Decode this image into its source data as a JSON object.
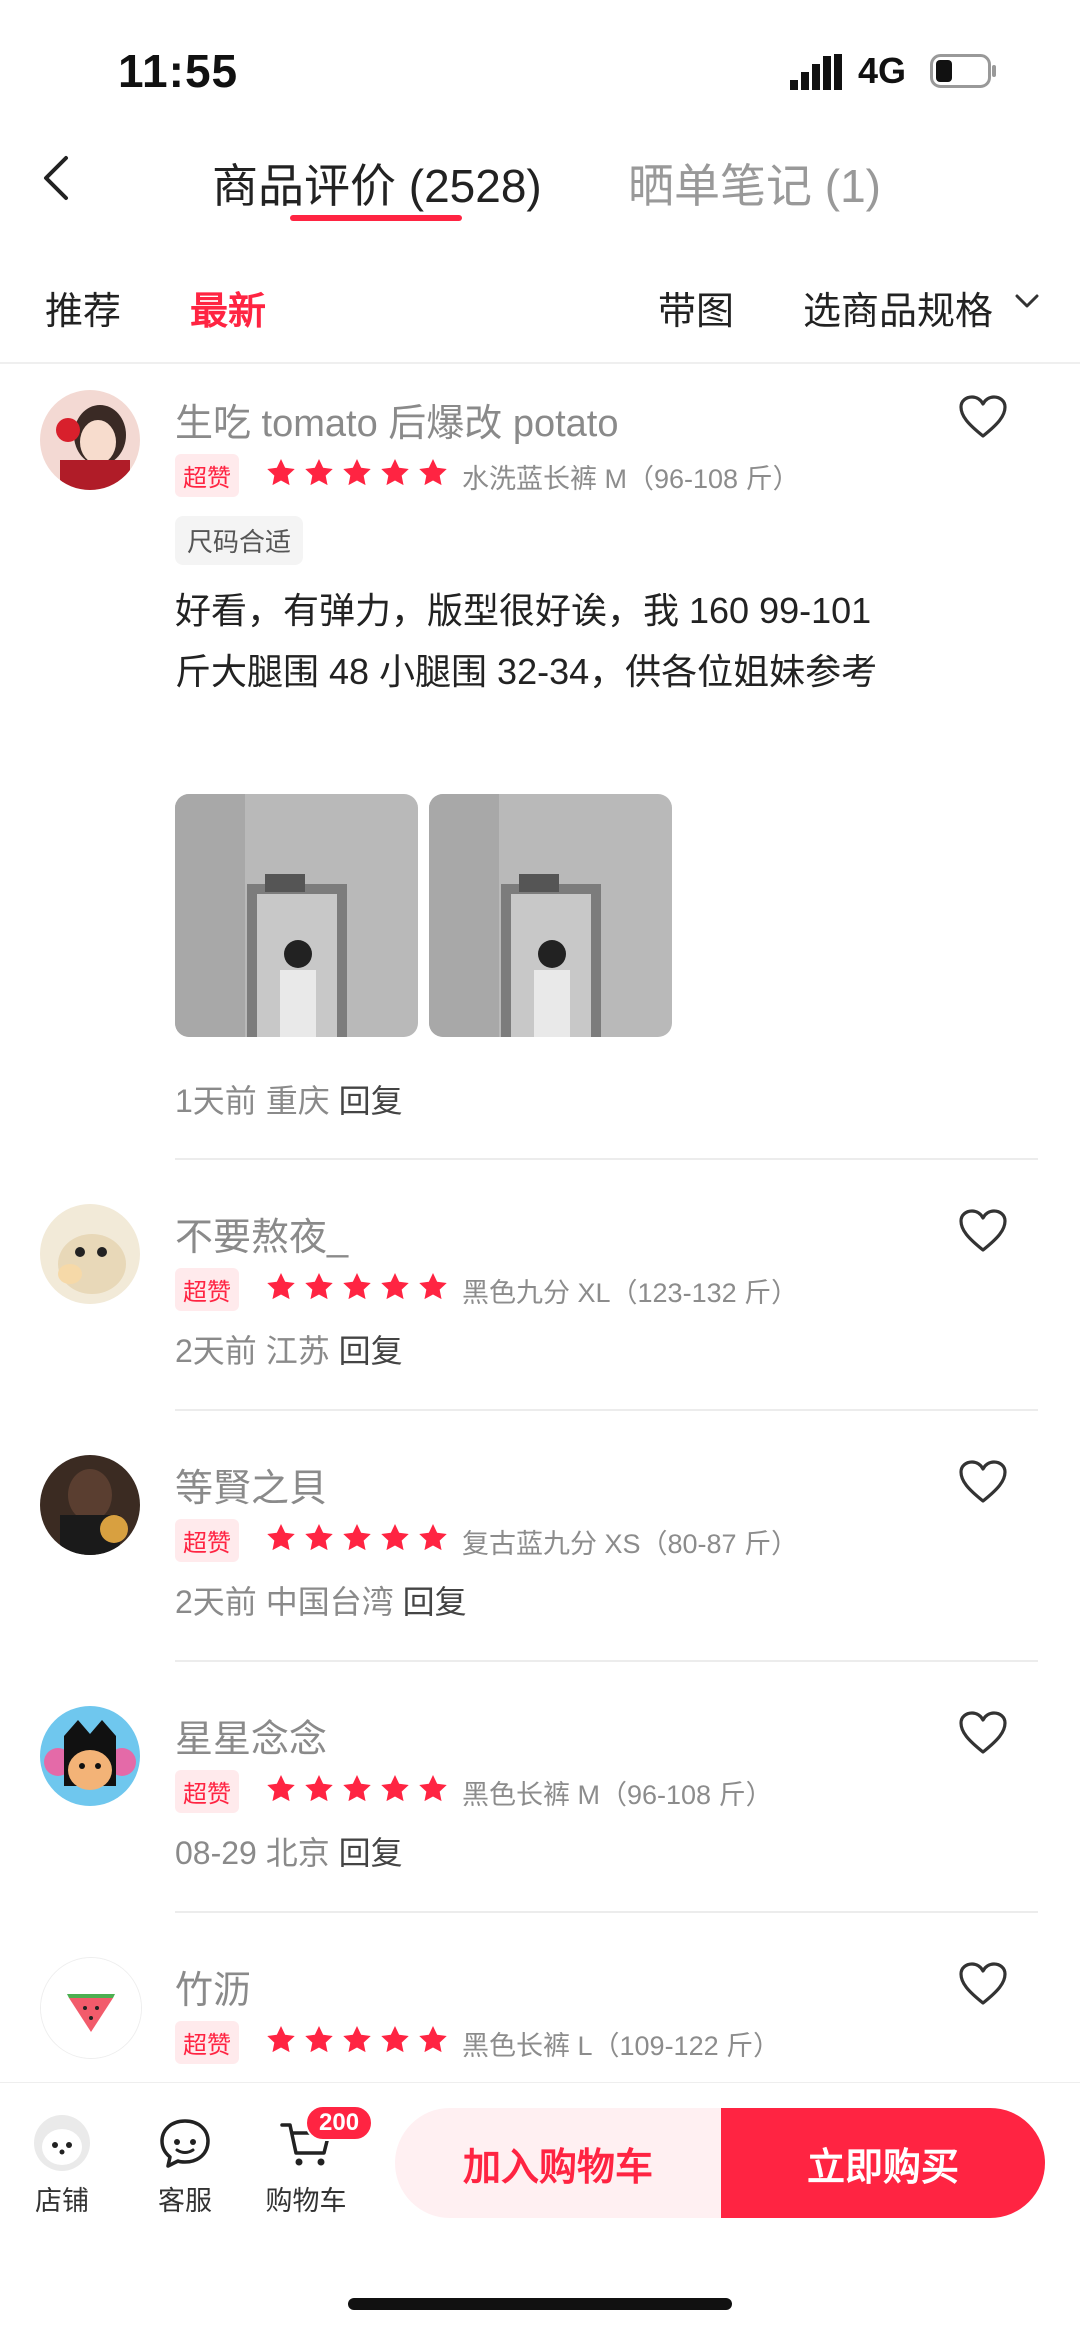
{
  "status": {
    "time": "11:55",
    "network": "4G"
  },
  "header": {
    "tabs": [
      {
        "label": "商品评价 (2528)",
        "active": true
      },
      {
        "label": "晒单笔记 (1)",
        "active": false
      }
    ]
  },
  "filters": {
    "recommend": "推荐",
    "latest": "最新",
    "with_images": "带图",
    "select_spec": "选商品规格"
  },
  "reviews": [
    {
      "name": "生吃 tomato 后爆改 potato",
      "badge": "超赞",
      "rating": 5,
      "spec": "水洗蓝长裤   M（96-108 斤）",
      "tag": "尺码合适",
      "text": "好看，有弹力，版型很好诶，我 160 99-101 斤大腿围 48 小腿围 32-34，供各位姐妹参考",
      "time_location": "1天前 重庆",
      "reply": "回复"
    },
    {
      "name": "不要熬夜_",
      "badge": "超赞",
      "rating": 5,
      "spec": "黑色九分   XL（123-132 斤）",
      "time_location": "2天前 江苏",
      "reply": "回复"
    },
    {
      "name": "等賢之貝",
      "badge": "超赞",
      "rating": 5,
      "spec": "复古蓝九分   XS（80-87 斤）",
      "time_location": "2天前 中国台湾",
      "reply": "回复"
    },
    {
      "name": "星星念念",
      "badge": "超赞",
      "rating": 5,
      "spec": "黑色长裤   M（96-108 斤）",
      "time_location": "08-29 北京",
      "reply": "回复"
    },
    {
      "name": "竹沥",
      "badge": "超赞",
      "rating": 5,
      "spec": "黑色长裤   L（109-122 斤）"
    }
  ],
  "bottom_bar": {
    "shop": "店铺",
    "service": "客服",
    "cart": "购物车",
    "cart_count": "200",
    "add_to_cart": "加入购物车",
    "buy_now": "立即购买"
  },
  "colors": {
    "accent": "#ff2442",
    "accent_light": "#fff0f2"
  },
  "icons": [
    "back-icon",
    "chevron-down-icon",
    "heart-icon",
    "star-icon",
    "chat-icon",
    "cart-icon",
    "signal-icon",
    "battery-icon"
  ]
}
